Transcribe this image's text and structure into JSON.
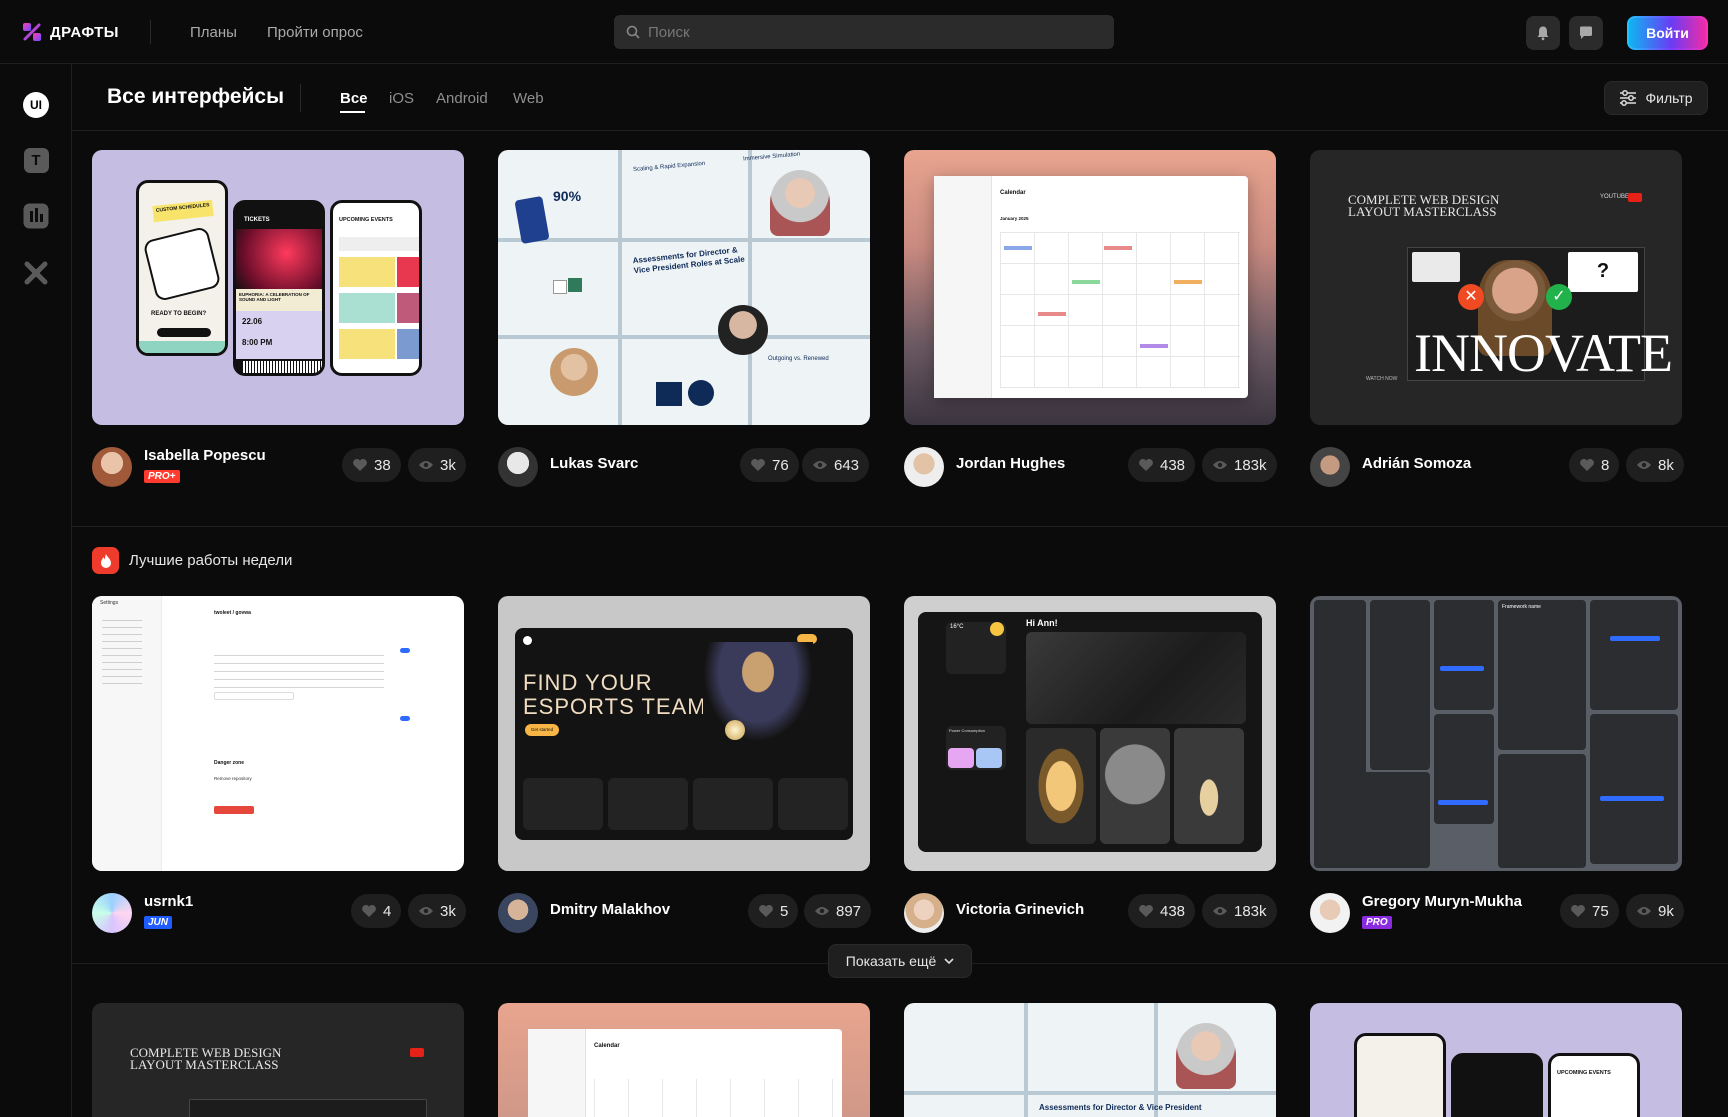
{
  "header": {
    "logo_text": "ДРАФТЫ",
    "nav": [
      "Планы",
      "Пройти опрос"
    ],
    "search_placeholder": "Поиск",
    "login_label": "Войти"
  },
  "sidebar": {
    "items": [
      {
        "name": "ui",
        "label": "UI",
        "icon": "ui-icon"
      },
      {
        "name": "text",
        "label": "T",
        "icon": "text-icon"
      },
      {
        "name": "charts",
        "icon": "chart-icon"
      },
      {
        "name": "tools",
        "icon": "tools-icon"
      }
    ]
  },
  "page": {
    "title": "Все интерфейсы",
    "tabs": [
      "Все",
      "iOS",
      "Android",
      "Web"
    ],
    "active_tab": "Все",
    "filter_label": "Фильтр"
  },
  "row1": [
    {
      "author": "Isabella Popescu",
      "badge": "PRO+",
      "likes": "38",
      "views": "3k"
    },
    {
      "author": "Lukas Svarc",
      "badge": "",
      "likes": "76",
      "views": "643"
    },
    {
      "author": "Jordan Hughes",
      "badge": "",
      "likes": "438",
      "views": "183k"
    },
    {
      "author": "Adrián Somoza",
      "badge": "",
      "likes": "8",
      "views": "8k"
    }
  ],
  "week": {
    "title": "Лучшие работы недели",
    "cards": [
      {
        "author": "usrnk1",
        "badge": "JUN",
        "likes": "4",
        "views": "3k"
      },
      {
        "author": "Dmitry Malakhov",
        "badge": "",
        "likes": "5",
        "views": "897"
      },
      {
        "author": "Victoria Grinevich",
        "badge": "",
        "likes": "438",
        "views": "183k"
      },
      {
        "author": "Gregory Muryn-Mukha",
        "badge": "PRO",
        "likes": "75",
        "views": "9k"
      }
    ],
    "more_label": "Показать ещё"
  },
  "thumbs": {
    "tickets": {
      "t1": "TICKETS",
      "t2": "UPCOMING EVENTS",
      "t3": "EUPHORIA: A CELEBRATION OF SOUND AND LIGHT",
      "t4": "READY TO BEGIN?",
      "t5": "22.06",
      "t6": "8:00 PM",
      "t7": "CUSTOM SCHEDULES"
    },
    "assess": {
      "t1": "90%",
      "t2": "Scaling & Rapid Expansion",
      "t3": "Immersive Simulation",
      "t4": "Assessments for Director & Vice President Roles at Scale",
      "t5": "Outgoing vs. Renewed"
    },
    "calendar": {
      "t1": "Calendar",
      "t2": "January 2025"
    },
    "innovate": {
      "t1": "COMPLETE WEB DESIGN LAYOUT MASTERCLASS",
      "t2": "INNOVATE",
      "t3": "YOUTUBE",
      "t4": "?",
      "t5": "WATCH NOW"
    },
    "settings": {
      "t1": "Settings",
      "t2": "twoleet / govwa",
      "t3": "Danger zone",
      "t4": "Remove repository"
    },
    "esports": {
      "t1": "FIND YOUR",
      "t2": "ESPORTS TEAM",
      "t3": "Get started"
    },
    "smart": {
      "t1": "Hi Ann!",
      "t2": "16°C",
      "t3": "Power Consumption"
    },
    "figma": {
      "t1": "Framework name"
    }
  },
  "row3": [
    {
      "thumb": "COMPLETE WEB DESIGN LAYOUT MASTERCLASS"
    },
    {
      "thumb": "Calendar"
    },
    {
      "thumb": "Assessments for Director & Vice President"
    },
    {
      "thumb": "UPCOMING EVENTS"
    }
  ],
  "colors": {
    "accent_pro_plus": "#ff3b2f",
    "accent_jun": "#1f5bff",
    "accent_pro": "#8a2be2",
    "bg": "#0b0b0b"
  }
}
